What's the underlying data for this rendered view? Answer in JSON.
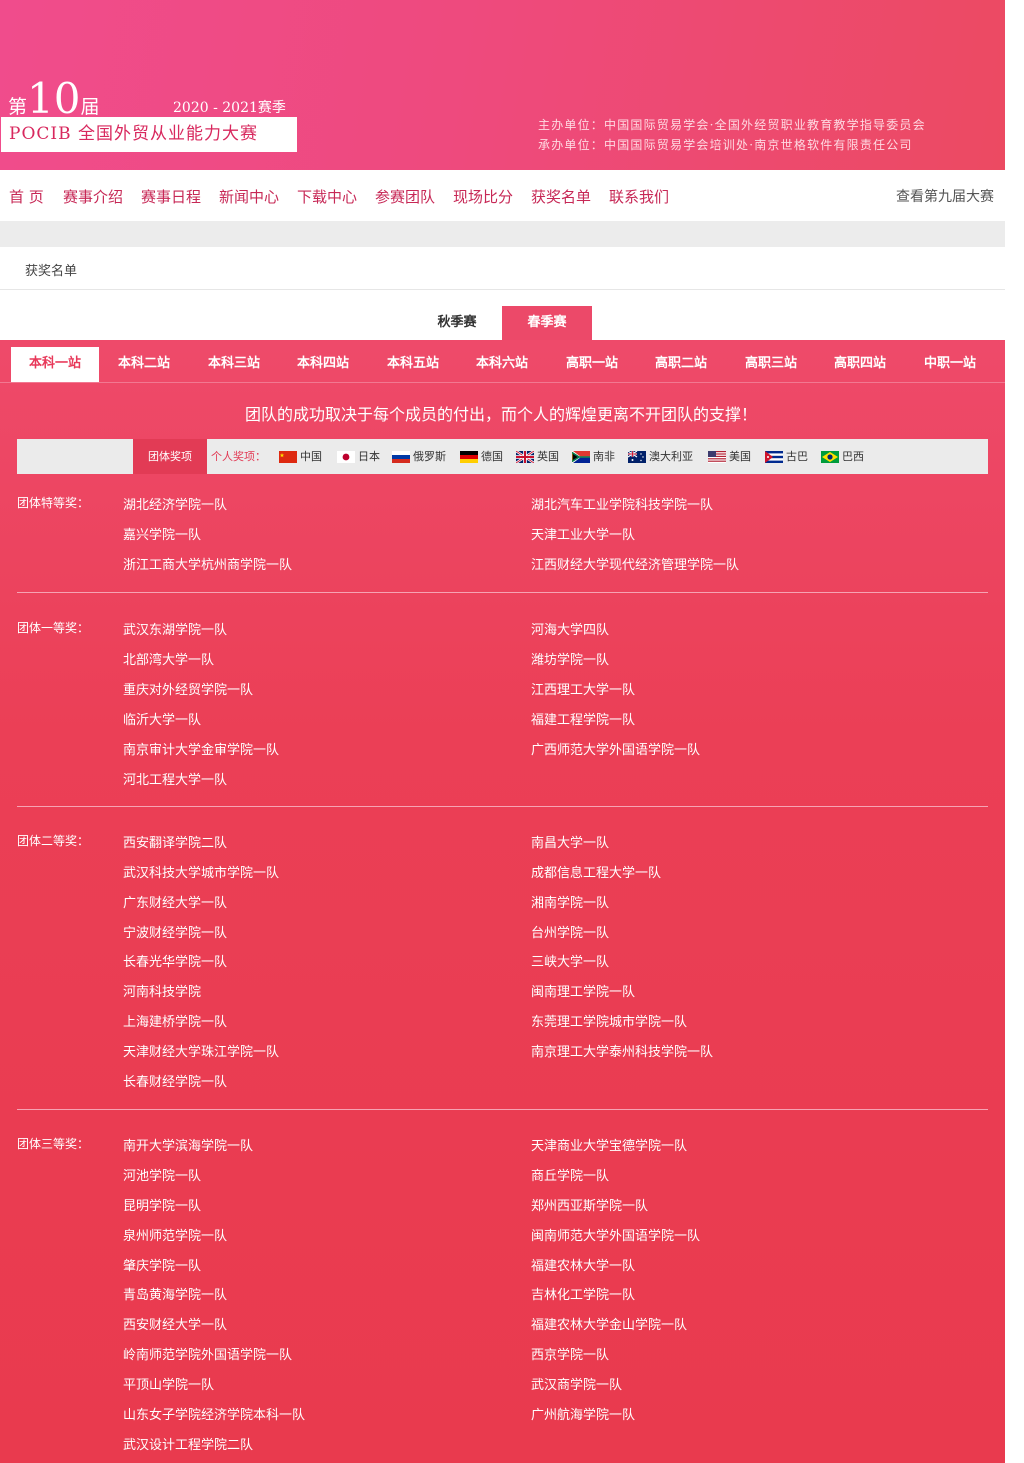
{
  "header": {
    "edition_pre": "第",
    "edition_num": "10",
    "edition_suf": "届",
    "season": "2020 - 2021赛季",
    "contest_title": "POCIB 全国外贸从业能力大赛",
    "organizer": "主办单位：中国国际贸易学会·全国外经贸职业教育教学指导委员会",
    "undertaker": "承办单位：中国国际贸易学会培训处·南京世格软件有限责任公司"
  },
  "nav": {
    "items": [
      "首 页",
      "赛事介绍",
      "赛事日程",
      "新闻中心",
      "下载中心",
      "参赛团队",
      "现场比分",
      "获奖名单",
      "联系我们"
    ],
    "right": "查看第九届大赛"
  },
  "breadcrumb": "获奖名单",
  "season_tabs": [
    "秋季赛",
    "春季赛"
  ],
  "stations": [
    "本科一站",
    "本科二站",
    "本科三站",
    "本科四站",
    "本科五站",
    "本科六站",
    "高职一站",
    "高职二站",
    "高职三站",
    "高职四站",
    "中职一站"
  ],
  "motto": "团队的成功取决于每个成员的付出，而个人的辉煌更离不开团队的支撑！",
  "filter": {
    "team": "团体奖项",
    "individual": "个人奖项：",
    "countries": [
      {
        "name": "中国",
        "flag": "china-flag-icon"
      },
      {
        "name": "日本",
        "flag": "japan-flag-icon"
      },
      {
        "name": "俄罗斯",
        "flag": "russia-flag-icon"
      },
      {
        "name": "德国",
        "flag": "germany-flag-icon"
      },
      {
        "name": "英国",
        "flag": "uk-flag-icon"
      },
      {
        "name": "南非",
        "flag": "south-africa-flag-icon"
      },
      {
        "name": "澳大利亚",
        "flag": "australia-flag-icon"
      },
      {
        "name": "美国",
        "flag": "usa-flag-icon"
      },
      {
        "name": "古巴",
        "flag": "cuba-flag-icon"
      },
      {
        "name": "巴西",
        "flag": "brazil-flag-icon"
      }
    ]
  },
  "awards": [
    {
      "label": "团体特等奖：",
      "left": [
        "湖北经济学院一队",
        "嘉兴学院一队",
        "浙江工商大学杭州商学院一队"
      ],
      "right": [
        "湖北汽车工业学院科技学院一队",
        "天津工业大学一队",
        "江西财经大学现代经济管理学院一队"
      ]
    },
    {
      "label": "团体一等奖：",
      "left": [
        "武汉东湖学院一队",
        "北部湾大学一队",
        "重庆对外经贸学院一队",
        "临沂大学一队",
        "南京审计大学金审学院一队",
        "河北工程大学一队"
      ],
      "right": [
        "河海大学四队",
        "潍坊学院一队",
        "江西理工大学一队",
        "福建工程学院一队",
        "广西师范大学外国语学院一队"
      ]
    },
    {
      "label": "团体二等奖：",
      "left": [
        "西安翻译学院二队",
        "武汉科技大学城市学院一队",
        "广东财经大学一队",
        "宁波财经学院一队",
        "长春光华学院一队",
        "河南科技学院",
        "上海建桥学院一队",
        "天津财经大学珠江学院一队",
        "长春财经学院一队"
      ],
      "right": [
        "南昌大学一队",
        "成都信息工程大学一队",
        "湘南学院一队",
        "台州学院一队",
        "三峡大学一队",
        "闽南理工学院一队",
        "东莞理工学院城市学院一队",
        "南京理工大学泰州科技学院一队"
      ]
    },
    {
      "label": "团体三等奖：",
      "left": [
        "南开大学滨海学院一队",
        "河池学院一队",
        "昆明学院一队",
        "泉州师范学院一队",
        "肇庆学院一队",
        "青岛黄海学院一队",
        "西安财经大学一队",
        "岭南师范学院外国语学院一队",
        "平顶山学院一队",
        "山东女子学院经济学院本科一队",
        "武汉设计工程学院二队"
      ],
      "right": [
        "天津商业大学宝德学院一队",
        "商丘学院一队",
        "郑州西亚斯学院一队",
        "闽南师范大学外国语学院一队",
        "福建农林大学一队",
        "吉林化工学院一队",
        "福建农林大学金山学院一队",
        "西京学院一队",
        "武汉商学院一队",
        "广州航海学院一队"
      ]
    }
  ]
}
